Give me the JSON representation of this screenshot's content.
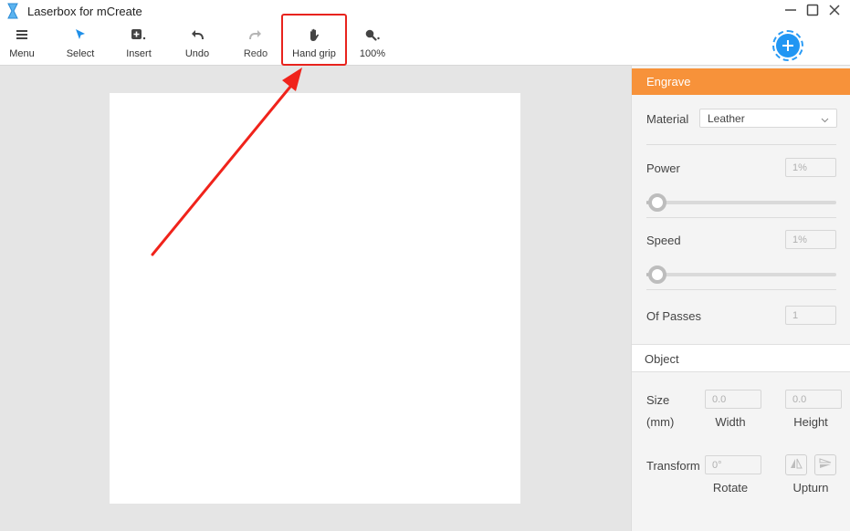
{
  "window": {
    "title": "Laserbox for mCreate"
  },
  "toolbar": {
    "menu": "Menu",
    "select": "Select",
    "insert": "Insert",
    "undo": "Undo",
    "redo": "Redo",
    "hand_grip": "Hand grip",
    "zoom": "100%"
  },
  "icons": {
    "app": "hourglass-icon",
    "menu": "hamburger-menu-icon",
    "select": "cursor-arrow-icon",
    "insert": "insert-square-icon",
    "undo": "undo-arrow-icon",
    "redo": "redo-arrow-icon",
    "hand_grip": "hand-icon",
    "zoom": "magnifier-icon",
    "add": "plus-circle-icon",
    "flip_vertical": "flip-vertical-icon",
    "flip_horizontal": "flip-horizontal-icon"
  },
  "colors": {
    "accent_orange": "#f7923a",
    "accent_blue": "#2196f3",
    "highlight_red": "#e8231d",
    "canvas_bg": "#e5e5e5"
  },
  "panel": {
    "engrave": {
      "header": "Engrave",
      "material_label": "Material",
      "material_value": "Leather",
      "power_label": "Power",
      "power_value": "1%",
      "power_level": 0.01,
      "speed_label": "Speed",
      "speed_value": "1%",
      "speed_level": 0.01,
      "passes_label": "Of Passes",
      "passes_value": "1"
    },
    "object": {
      "header": "Object",
      "size_label": "Size",
      "unit_label": "(mm)",
      "width_value": "0.0",
      "height_value": "0.0",
      "width_label": "Width",
      "height_label": "Height",
      "transform_label": "Transform",
      "rotate_value": "0°",
      "rotate_label": "Rotate",
      "upturn_label": "Upturn"
    }
  }
}
